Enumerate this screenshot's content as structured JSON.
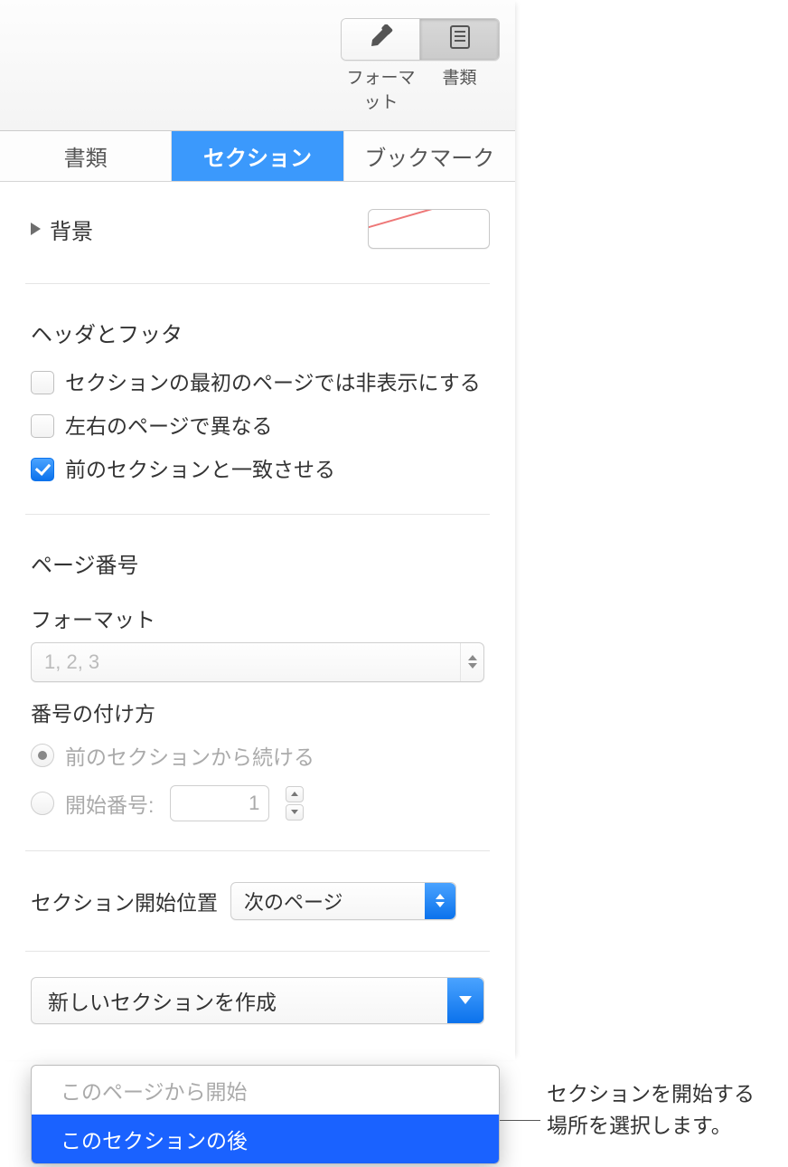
{
  "toolbar": {
    "format_label": "フォーマット",
    "document_label": "書類"
  },
  "tabs": {
    "document": "書類",
    "section": "セクション",
    "bookmark": "ブックマーク"
  },
  "background": {
    "label": "背景"
  },
  "header_footer": {
    "title": "ヘッダとフッタ",
    "hide_first": "セクションの最初のページでは非表示にする",
    "diff_lr": "左右のページで異なる",
    "match_prev": "前のセクションと一致させる"
  },
  "page_number": {
    "title": "ページ番号",
    "format_label": "フォーマット",
    "format_value": "1, 2, 3",
    "numbering_label": "番号の付け方",
    "continue_label": "前のセクションから続ける",
    "start_at_label": "開始番号:",
    "start_at_value": "1"
  },
  "section_start": {
    "label": "セクション開始位置",
    "value": "次のページ"
  },
  "create_section": {
    "label": "新しいセクションを作成",
    "menu": {
      "opt1": "このページから開始",
      "opt2": "このセクションの後"
    }
  },
  "callout": {
    "line1": "セクションを開始する",
    "line2": "場所を選択します。"
  }
}
